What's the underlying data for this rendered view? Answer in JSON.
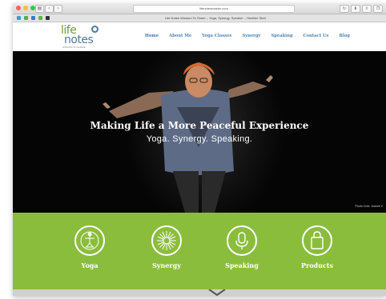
{
  "browser": {
    "url": "lifenotesmaster.com",
    "tab_title": "Life Notes Wisdom To Share – Yoga, Synergy, Speaker – Heather Stott",
    "back_label": "‹",
    "forward_label": "›",
    "sidebar_label": "▤"
  },
  "site": {
    "logo_line1": "life",
    "logo_line2": "notes",
    "logo_tagline": "WISDOM TO SHARE"
  },
  "nav": {
    "items": [
      "Home",
      "About Me",
      "Yoga Classes",
      "Synergy",
      "Speaking",
      "Contact Us",
      "Blog"
    ]
  },
  "hero": {
    "headline": "Making Life a More Peaceful Experience",
    "subline": "Yoga. Synergy. Speaking.",
    "credit": "Photo Cred: Joanne V"
  },
  "services": [
    {
      "label": "Yoga",
      "icon": "yoga-figure-icon"
    },
    {
      "label": "Synergy",
      "icon": "burst-icon"
    },
    {
      "label": "Speaking",
      "icon": "microphone-icon"
    },
    {
      "label": "Products",
      "icon": "shopping-bag-icon"
    }
  ],
  "colors": {
    "green": "#8bbd3c",
    "nav_blue": "#4a86b5",
    "logo_green": "#6f9f2e",
    "logo_blue": "#4f79a0"
  }
}
